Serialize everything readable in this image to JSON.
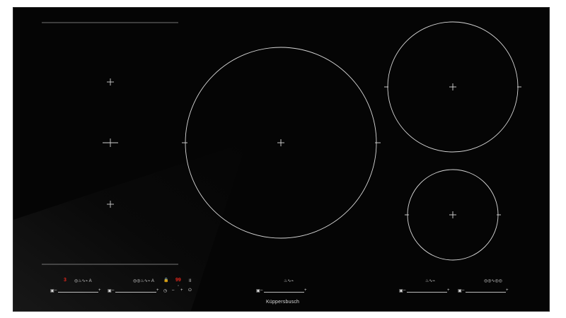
{
  "brand": "Küppersbusch",
  "zones": [
    {
      "name": "flex-zone-left",
      "type": "flex"
    },
    {
      "name": "large-center-zone",
      "type": "round"
    },
    {
      "name": "top-right-zone",
      "type": "round"
    },
    {
      "name": "bottom-right-zone",
      "type": "round"
    }
  ],
  "controls": {
    "zone1": {
      "level": "3",
      "icons": "◎♨∿⌁ A",
      "minus": "–",
      "plus": "+"
    },
    "zone2": {
      "icons": "◎◎♨∿⌁ A",
      "minus": "–",
      "plus": "+"
    },
    "timer": {
      "lock": "🔒",
      "display": "99",
      "minus": "–",
      "plus": "+",
      "pause": "II",
      "clock": "◷",
      "power": "⏻"
    },
    "zone3": {
      "icons": "♨∿⌁",
      "minus": "–",
      "plus": "+"
    },
    "zone4": {
      "icons": "♨∿⌁",
      "minus": "–",
      "plus": "+"
    },
    "zone5": {
      "icons": "◎◎∿◎◎",
      "minus": "–",
      "plus": "+"
    }
  },
  "colors": {
    "glass": "#050505",
    "marking": "#cfcfcf",
    "display": "#e4271d"
  }
}
